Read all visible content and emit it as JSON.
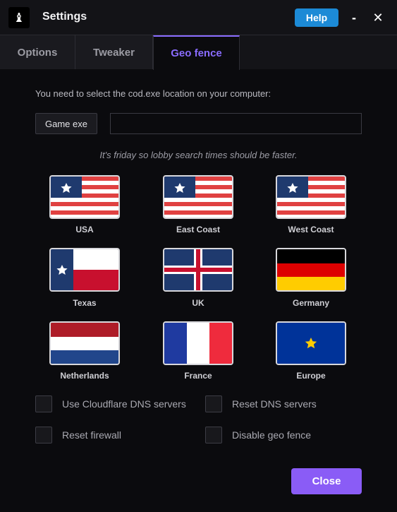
{
  "window": {
    "title": "Settings",
    "logo_glyph": "♝",
    "help_label": "Help",
    "minimize_glyph": "-",
    "close_glyph": "✕"
  },
  "tabs": [
    {
      "label": "Options",
      "active": false
    },
    {
      "label": "Tweaker",
      "active": false
    },
    {
      "label": "Geo fence",
      "active": true
    }
  ],
  "geo": {
    "instruction": "You need to select the cod.exe location on your computer:",
    "game_exe_label": "Game exe",
    "path_value": "",
    "notice": "It's friday so lobby search times should be faster."
  },
  "regions": [
    {
      "label": "USA",
      "flag": "usa-flag-icon"
    },
    {
      "label": "East Coast",
      "flag": "usa-flag-icon"
    },
    {
      "label": "West Coast",
      "flag": "usa-flag-icon"
    },
    {
      "label": "Texas",
      "flag": "texas-flag-icon"
    },
    {
      "label": "UK",
      "flag": "uk-flag-icon"
    },
    {
      "label": "Germany",
      "flag": "germany-flag-icon"
    },
    {
      "label": "Netherlands",
      "flag": "netherlands-flag-icon"
    },
    {
      "label": "France",
      "flag": "france-flag-icon"
    },
    {
      "label": "Europe",
      "flag": "europe-flag-icon"
    }
  ],
  "options": {
    "cloudflare": {
      "label": "Use Cloudflare DNS servers",
      "checked": false
    },
    "reset_dns": {
      "label": "Reset DNS servers",
      "checked": false
    },
    "reset_firewall": {
      "label": "Reset firewall",
      "checked": false
    },
    "disable_geo": {
      "label": "Disable geo fence",
      "checked": false
    }
  },
  "footer": {
    "close_label": "Close"
  },
  "colors": {
    "accent": "#8a5cf6",
    "help": "#1c8ad6",
    "background": "#0b0b0e"
  }
}
